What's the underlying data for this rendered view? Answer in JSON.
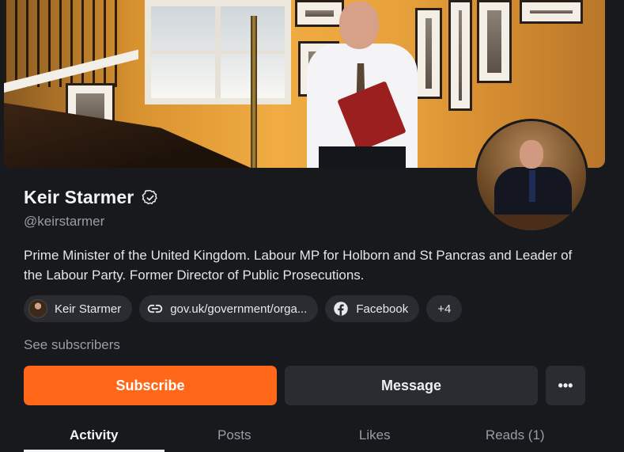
{
  "profile": {
    "name": "Keir Starmer",
    "handle": "@keirstarmer",
    "bio": "Prime Minister of the United Kingdom. Labour MP for Holborn and St Pancras and Leader of the Labour Party. Former Director of Public Prosecutions.",
    "verified_icon": "verified-badge-icon"
  },
  "links": {
    "profile_chip": "Keir Starmer",
    "website_chip": "gov.uk/government/orga...",
    "facebook_chip": "Facebook",
    "more_chip": "+4"
  },
  "subscribers_link": "See subscribers",
  "actions": {
    "subscribe": "Subscribe",
    "message": "Message",
    "more": "•••"
  },
  "tabs": [
    {
      "label": "Activity",
      "active": true
    },
    {
      "label": "Posts"
    },
    {
      "label": "Likes"
    },
    {
      "label": "Reads (1)"
    }
  ],
  "colors": {
    "background": "#17191d",
    "accent": "#ff6719",
    "surface": "#2a2c31",
    "muted_text": "#9a9da4"
  }
}
